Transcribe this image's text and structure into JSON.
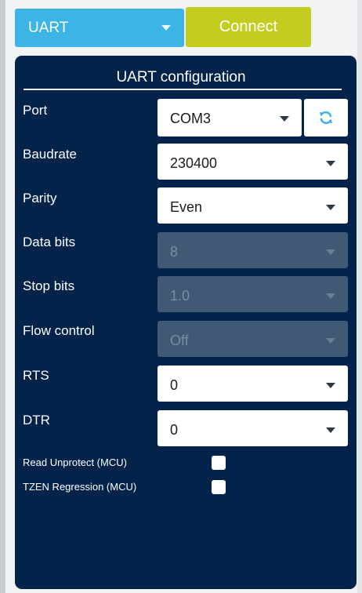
{
  "toolbar": {
    "interface": "UART",
    "connect_label": "Connect"
  },
  "panel": {
    "title": "UART configuration",
    "fields": {
      "port": {
        "label": "Port",
        "value": "COM3"
      },
      "baudrate": {
        "label": "Baudrate",
        "value": "230400"
      },
      "parity": {
        "label": "Parity",
        "value": "Even"
      },
      "data_bits": {
        "label": "Data bits",
        "value": "8",
        "disabled": true
      },
      "stop_bits": {
        "label": "Stop bits",
        "value": "1.0",
        "disabled": true
      },
      "flow_control": {
        "label": "Flow control",
        "value": "Off",
        "disabled": true
      },
      "rts": {
        "label": "RTS",
        "value": "0"
      },
      "dtr": {
        "label": "DTR",
        "value": "0"
      }
    },
    "options": {
      "read_unprotect": {
        "label": "Read Unprotect (MCU)",
        "checked": false
      },
      "tzen_regression": {
        "label": "TZEN Regression (MCU)",
        "checked": false
      }
    }
  },
  "icons": {
    "refresh": "refresh-icon",
    "dropdown": "chevron-down-icon"
  },
  "colors": {
    "interface_select": "#3cb4e5",
    "connect_button": "#c2cd1f",
    "panel_background": "#03234b",
    "disabled_field": "#405975",
    "refresh_icon": "#3cb4e5"
  }
}
